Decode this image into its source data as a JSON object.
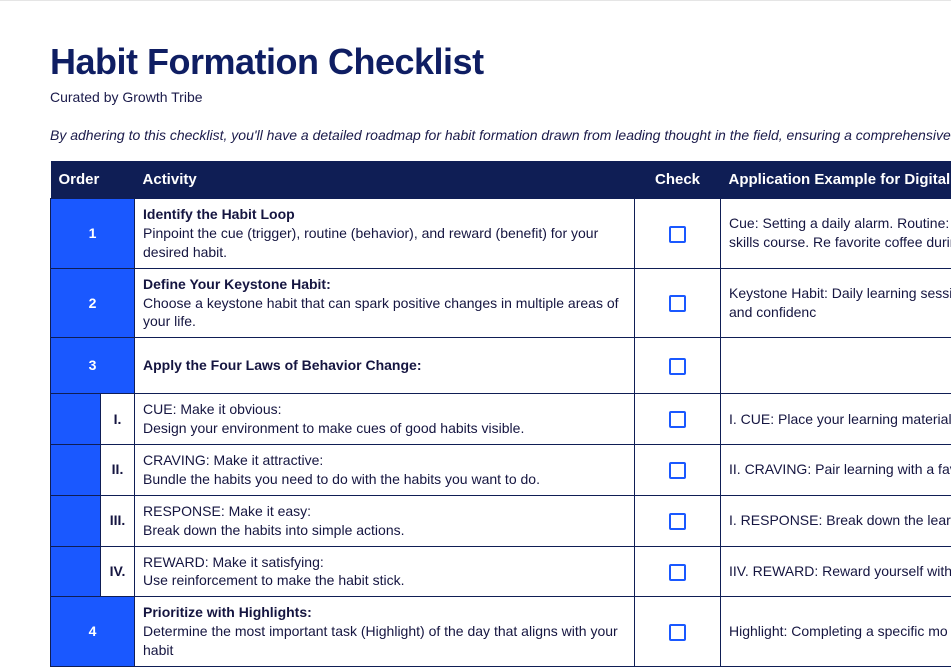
{
  "header": {
    "title": "Habit Formation Checklist",
    "subtitle": "Curated by Growth Tribe",
    "intro": "By adhering to this checklist, you'll have a detailed roadmap for habit formation drawn from leading thought in the field, ensuring a comprehensive a"
  },
  "columns": {
    "order": "Order",
    "activity": "Activity",
    "check": "Check",
    "application": "Application Example for Digital Skil"
  },
  "rows": {
    "r1": {
      "order": "1",
      "title": "Identify the Habit Loop",
      "desc": "Pinpoint the cue (trigger), routine (behavior), and reward (benefit) for your desired habit.",
      "app": "Cue: Setting a daily alarm. Routine: minutes on a digital skills course. Re favorite coffee during the learning s"
    },
    "r2": {
      "order": "2",
      "title": "Define Your Keystone Habit:",
      "desc": "Choose a keystone habit that can spark positive changes in multiple areas of your life.",
      "app": "Keystone Habit: Daily learning sessi increased proficiency and confidenc"
    },
    "r3": {
      "order": "3",
      "title": "Apply the Four Laws of Behavior Change:",
      "desc": "",
      "app": ""
    },
    "r3a": {
      "sub": "I.",
      "title": "CUE: Make it obvious:",
      "desc": "Design your environment to make cues of good habits visible.",
      "app": "I. CUE: Place your learning materials"
    },
    "r3b": {
      "sub": "II.",
      "title": "CRAVING: Make it attractive:",
      "desc": "Bundle the habits you need to do with the habits you want to do.",
      "app": "II. CRAVING: Pair learning with a fav"
    },
    "r3c": {
      "sub": "III.",
      "title": "RESPONSE: Make it easy:",
      "desc": "Break down the habits into simple actions.",
      "app": "I. RESPONSE: Break down the learni"
    },
    "r3d": {
      "sub": "IV.",
      "title": "REWARD: Make it satisfying:",
      "desc": "Use reinforcement to make the habit stick.",
      "app": "IIV. REWARD: Reward yourself with a"
    },
    "r4": {
      "order": "4",
      "title": "Prioritize with Highlights:",
      "desc": "Determine the most important task (Highlight) of the day that aligns with your habit",
      "app": "Highlight: Completing a specific mo"
    }
  }
}
